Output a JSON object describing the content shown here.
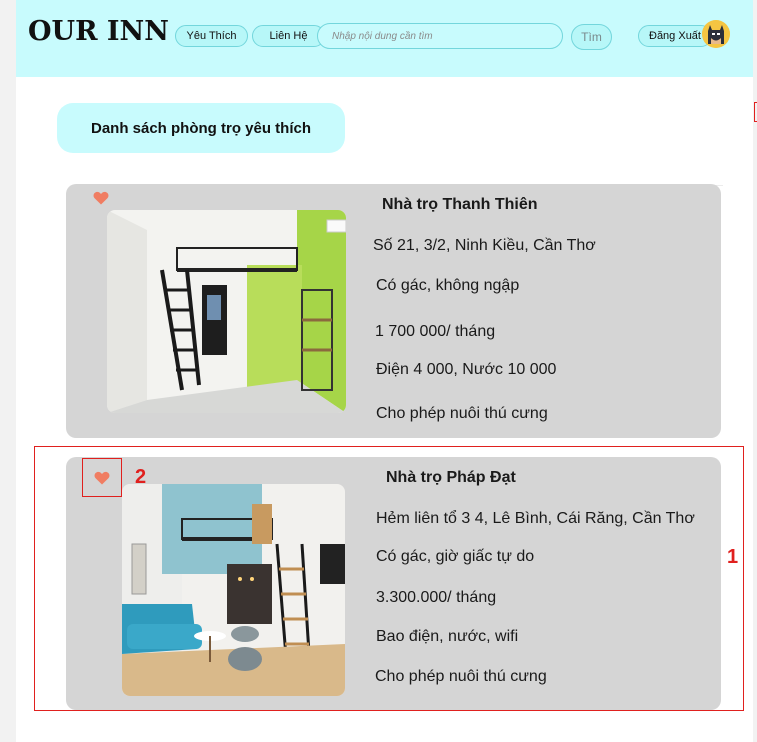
{
  "header": {
    "logo": "OUR INN",
    "nav": [
      "Yêu Thích",
      "Liên Hệ"
    ],
    "search_placeholder": "Nhập nội dung cần tìm",
    "search_button": "Tìm",
    "logout": "Đăng Xuất",
    "avatar_icon": "batman-avatar-icon"
  },
  "section": {
    "title": "Danh sách phòng trọ yêu thích"
  },
  "rooms": [
    {
      "name": "Nhà trọ Thanh Thiên",
      "address": "Số 21, 3/2, Ninh Kiều, Cần Thơ",
      "feature": "Có gác, không ngập",
      "price": "1 700 000/ tháng",
      "utilities": "Điện 4 000, Nước 10 000",
      "pets": "Cho phép nuôi thú cưng",
      "favorited": true
    },
    {
      "name": "Nhà trọ Pháp Đạt",
      "address": "Hẻm liên tổ 3 4, Lê Bình, Cái Răng, Cần Thơ",
      "feature": "Có gác, giờ giấc tự do",
      "price": "3.300.000/ tháng",
      "utilities": "Bao điện, nước, wifi",
      "pets": "Cho phép nuôi thú cưng",
      "favorited": true
    }
  ],
  "annotations": [
    "1",
    "2"
  ],
  "colors": {
    "header_bg": "#c8fbfd",
    "pill_bg": "#b7f7f8",
    "card_bg": "#d5d5d5",
    "heart": "#f07d62",
    "annotation": "#e0201e"
  }
}
